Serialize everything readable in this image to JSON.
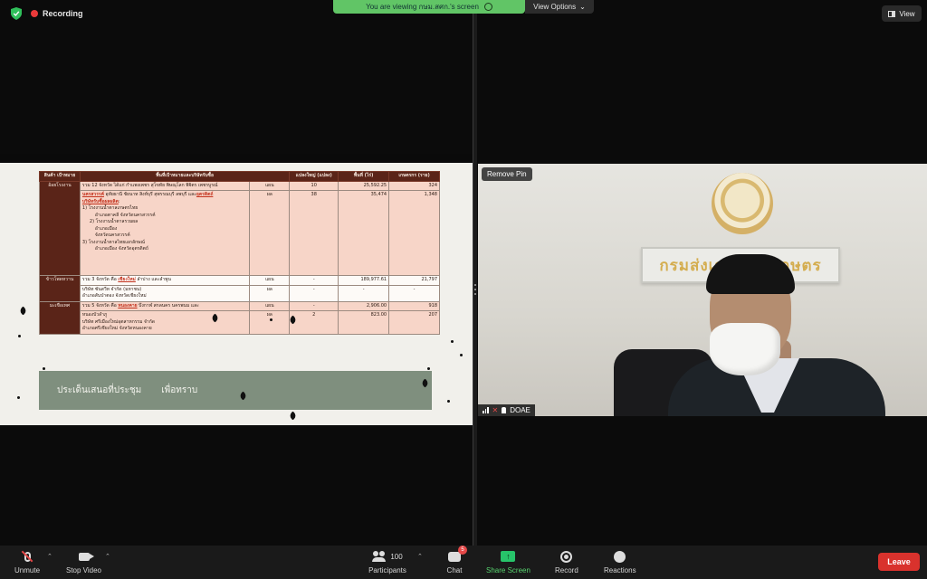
{
  "status": {
    "recording_label": "Recording",
    "viewing_banner": "You are viewing กษม.สศก.'s screen",
    "view_options_label": "View Options",
    "view_button_label": "View"
  },
  "slide": {
    "headers": {
      "product": "สินค้า เป้าหมาย",
      "area": "พื้นที่เป้าหมายและบริษัทรับซื้อ",
      "plots": "แปลงใหญ่ (แปลง)",
      "area_rai": "พื้นที่ (ไร่)",
      "farmers": "เกษตรกร (ราย)"
    },
    "rows": {
      "r1": {
        "product": "อ้อยโรงงาน",
        "desc_1": "รวม 12 จังหวัด ได้แก่ กำแพงเพชร สุโขทัย พิษณุโลก พิจิตร เพชรบูรณ์",
        "desc_2_link": "นครสวรรค์",
        "desc_2_rest": " อุทัยธานี ชัยนาท สิงห์บุรี สุพรรณบุรี ลพบุรี และ",
        "desc_2_link2": "อุตรดิตถ์",
        "desc_3_link": "บริษัทรับซื้อผลผลิต",
        "desc_3_rest": ":",
        "item_1": "1) โรงงานน้ำตาลเกษตรไทย",
        "item_1a": "อำเภอตาคลี จังหวัดนครสวรรค์",
        "item_2": "2) โรงงานน้ำตาลรวมผล",
        "item_2a": "อำเภอเมือง",
        "item_2b": "จังหวัดนครสวรรค์",
        "item_3": "3) โรงงานน้ำตาลไทยเอกลักษณ์",
        "item_3a": "อำเภอเมือง จังหวัดอุตรดิตถ์",
        "unit_a": "แผน",
        "unit_b": "ผล",
        "plots_a": "10",
        "plots_b": "38",
        "rai_a": "25,592.25",
        "rai_b": "35,474",
        "farm_a": "324",
        "farm_b": "1,348"
      },
      "r2": {
        "product": "ข้าวโพดหวาน",
        "desc_1_pre": "รวม 3 จังหวัด คือ ",
        "desc_1_link": "เชียงใหม่",
        "desc_1_post": " ลำปาง และลำพูน",
        "desc_2": "บริษัท ซันสวีท จำกัด (มหาชน)",
        "desc_3": "อำเภอสันป่าตอง จังหวัดเชียงใหม่",
        "unit_a": "แผน",
        "unit_b": "ผล",
        "plots_a": "-",
        "plots_b": "-",
        "rai_a": "189,977.61",
        "rai_b": "-",
        "farm_a": "21,797",
        "farm_b": "-"
      },
      "r3": {
        "product": "มะเขือเทศ",
        "desc_1_pre": "รวม 5 จังหวัด คือ ",
        "desc_1_link": "หนองคาย",
        "desc_1_post": " บึงกาฬ สกลนคร นครพนม และ",
        "desc_2": "หนองบัวลำภู",
        "desc_3": "บริษัท ศรีเมืองใหม่อุตสาหกรรม จำกัด",
        "desc_4": "อำเภอศรีเชียงใหม่ จังหวัดหนองคาย",
        "unit_a": "แผน",
        "unit_b": "ผล",
        "plots_a": "-",
        "plots_b": "2",
        "rai_a": "2,906.00",
        "rai_b": "823.00",
        "farm_a": "918",
        "farm_b": "207"
      }
    },
    "agenda_title": "ประเด็นเสนอที่ประชุม",
    "agenda_value": "เพื่อทราบ"
  },
  "camera": {
    "remove_pin_label": "Remove Pin",
    "participant_name": "DOAE",
    "sign_text": "กรมส่งเสริมการเกษตร"
  },
  "toolbar": {
    "unmute": "Unmute",
    "stop_video": "Stop Video",
    "participants_label": "Participants",
    "participants_count": "100",
    "chat": "Chat",
    "chat_badge": "5",
    "share_screen": "Share Screen",
    "record": "Record",
    "reactions": "Reactions",
    "leave": "Leave"
  },
  "colors": {
    "leave": "#d9322d",
    "share_green": "#27c46a",
    "banner_green": "#61c566",
    "table_header": "#5a2418",
    "table_pink": "#f7d5c8",
    "agenda_box": "#7f8f7e"
  }
}
